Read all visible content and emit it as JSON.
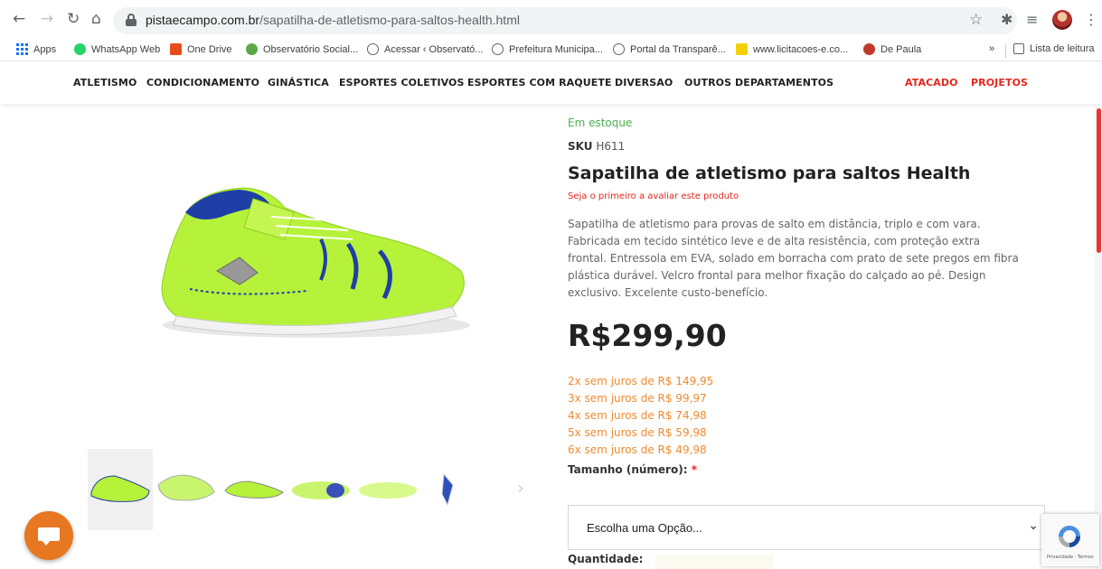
{
  "browser": {
    "url_domain": "pistaecampo.com.br",
    "url_path": "/sapatilha-de-atletismo-para-saltos-health.html",
    "bookmarks": [
      {
        "label": "Apps",
        "icon": "apps-grid-icon"
      },
      {
        "label": "WhatsApp Web",
        "icon": "whatsapp-icon",
        "color": "#25d366"
      },
      {
        "label": "One Drive",
        "icon": "office-icon",
        "color": "#e74c1c"
      },
      {
        "label": "Observatório Social...",
        "icon": "observatorio-icon",
        "color": "#5ba84a"
      },
      {
        "label": "Acessar ‹ Observató...",
        "icon": "globe-icon",
        "color": "#5f6368"
      },
      {
        "label": "Prefeitura Municipa...",
        "icon": "globe-icon",
        "color": "#5f6368"
      },
      {
        "label": "Portal da Transparê...",
        "icon": "globe-icon",
        "color": "#5f6368"
      },
      {
        "label": "www.licitacoes-e.co...",
        "icon": "banco-brasil-icon",
        "color": "#f5d000"
      },
      {
        "label": "De Paula",
        "icon": "depaula-icon",
        "color": "#c0392b"
      }
    ],
    "more_bookmarks": "»",
    "reading_list": "Lista de leitura"
  },
  "nav": {
    "items": [
      "ATLETISMO",
      "CONDICIONAMENTO",
      "GINÁSTICA",
      "ESPORTES COLETIVOS",
      "ESPORTES COM RAQUETE",
      "DIVERSAO",
      "OUTROS DEPARTAMENTOS"
    ],
    "highlight": [
      "ATACADO",
      "PROJETOS"
    ],
    "highlight_color": "#e4261c"
  },
  "product": {
    "stock": "Em estoque",
    "sku_label": "SKU",
    "sku": "H611",
    "title": "Sapatilha de atletismo para saltos Health",
    "review_link": "Seja o primeiro a avaliar este produto",
    "description": "Sapatilha de atletismo para provas de salto em distância, triplo e com vara. Fabricada em tecido sintético leve e de alta resistência, com proteção extra frontal. Entressola em EVA, solado em borracha com prato de sete pregos em fibra plástica durável. Velcro frontal para melhor fixação do calçado ao pé. Design exclusivo. Excelente custo-benefício.",
    "price": "R$299,90",
    "installments": [
      "2x sem juros de R$ 149,95",
      "3x sem juros de R$ 99,97",
      "4x sem juros de R$ 74,98",
      "5x sem juros de R$ 59,98",
      "6x sem juros de R$ 49,98"
    ],
    "size_label": "Tamanho (número):",
    "required_mark": "*",
    "size_select": "Escolha uma Opção...",
    "quantity_label": "Quantidade:",
    "shoe_color": "#b6f23a",
    "accent_color": "#1f3fa6"
  },
  "widgets": {
    "recaptcha_text": "Privacidade - Termos"
  }
}
